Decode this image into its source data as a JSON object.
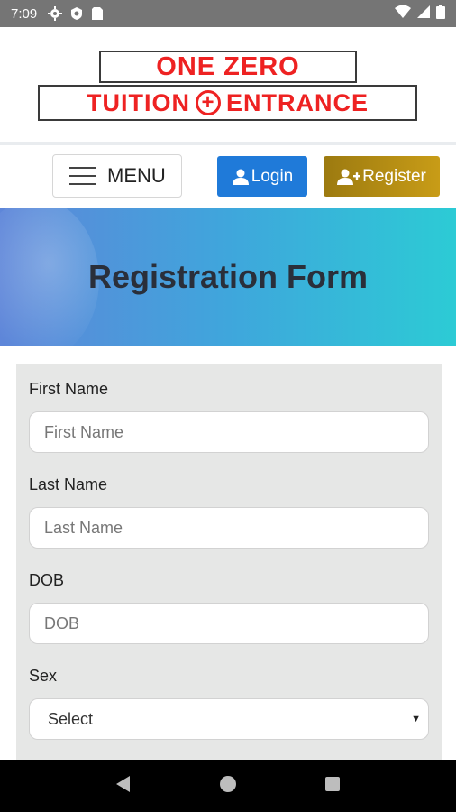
{
  "status_bar": {
    "time": "7:09",
    "icons": [
      "gear-icon",
      "shield-icon",
      "sim-card-icon"
    ],
    "right_icons": [
      "wifi-icon",
      "signal-icon",
      "battery-icon"
    ]
  },
  "header": {
    "logo_line1": "ONE ZERO",
    "logo_line2_left": "TUITION",
    "logo_plus": "+",
    "logo_line2_right": "ENTRANCE"
  },
  "nav": {
    "menu_label": "MENU",
    "login_label": "Login",
    "register_label": "Register"
  },
  "banner": {
    "title": "Registration Form"
  },
  "form": {
    "first_name": {
      "label": "First Name",
      "placeholder": "First Name"
    },
    "last_name": {
      "label": "Last Name",
      "placeholder": "Last Name"
    },
    "dob": {
      "label": "DOB",
      "placeholder": "DOB"
    },
    "sex": {
      "label": "Sex",
      "value": "Select"
    }
  },
  "colors": {
    "accent_login": "#1f7ad9",
    "accent_register": "#b08a14",
    "brand_red": "#ee2222"
  }
}
